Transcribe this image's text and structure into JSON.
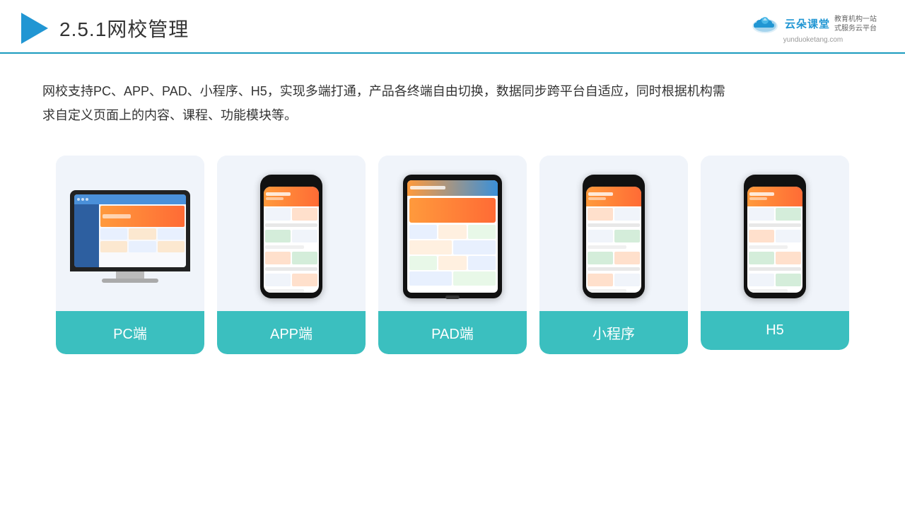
{
  "header": {
    "section_number": "2.5.1",
    "title": "网校管理",
    "logo": {
      "brand": "云朵课堂",
      "url": "yunduoketang.com",
      "slogan_line1": "教育机构一站",
      "slogan_line2": "式服务云平台"
    }
  },
  "description": {
    "text": "网校支持PC、APP、PAD、小程序、H5，实现多端打通，产品各终端自由切换，数据同步跨平台自适应，同时根据机构需求自定义页面上的内容、课程、功能模块等。"
  },
  "cards": [
    {
      "id": "pc",
      "label": "PC端",
      "device": "pc"
    },
    {
      "id": "app",
      "label": "APP端",
      "device": "phone"
    },
    {
      "id": "pad",
      "label": "PAD端",
      "device": "tablet"
    },
    {
      "id": "miniprogram",
      "label": "小程序",
      "device": "phone2"
    },
    {
      "id": "h5",
      "label": "H5",
      "device": "phone3"
    }
  ],
  "colors": {
    "accent": "#3bbfbf",
    "header_line": "#1a9bbf",
    "logo_blue": "#2196d3",
    "text_dark": "#333333",
    "card_bg": "#f0f4fa"
  }
}
